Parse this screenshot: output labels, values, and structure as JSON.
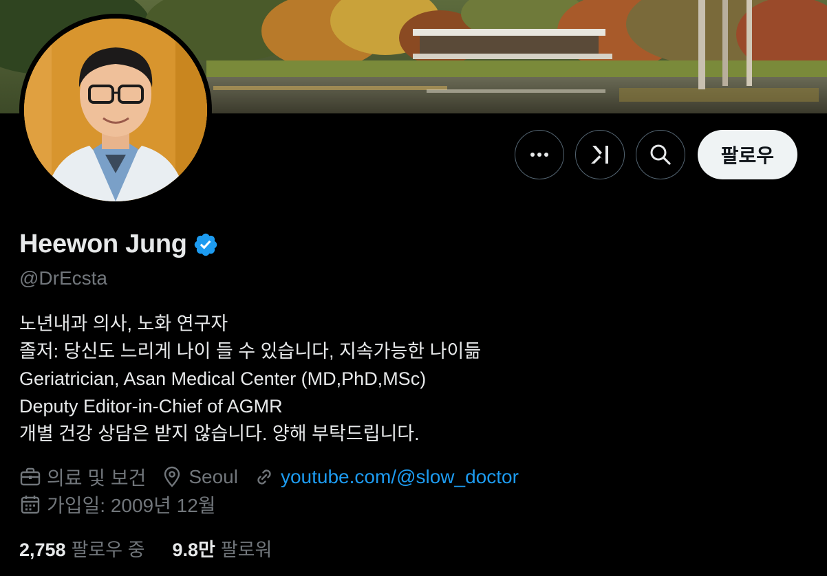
{
  "profile": {
    "name": "Heewon Jung",
    "handle": "@DrEcsta",
    "verified": true,
    "bio": [
      "노년내과 의사, 노화 연구자",
      "졸저: 당신도 느리게 나이 들 수 있습니다, 지속가능한 나이듦",
      "Geriatrician, Asan Medical Center (MD,PhD,MSc)",
      "Deputy Editor-in-Chief of AGMR",
      "개별 건강 상담은 받지 않습니다. 양해 부탁드립니다."
    ],
    "category": "의료 및 보건",
    "location": "Seoul",
    "website": "youtube.com/@slow_doctor",
    "joined": "가입일: 2009년 12월"
  },
  "actions": {
    "more_icon": "more-horizontal-icon",
    "grok_icon": "grok-icon",
    "search_icon": "search-icon",
    "follow_label": "팔로우"
  },
  "stats": {
    "following_count": "2,758",
    "following_label": "팔로우 중",
    "followers_count": "9.8만",
    "followers_label": "팔로워"
  },
  "colors": {
    "background": "#000000",
    "text_primary": "#e7e9ea",
    "text_secondary": "#71767b",
    "link": "#1d9bf0",
    "verified_badge": "#1d9bf0",
    "follow_button_bg": "#eff3f4"
  }
}
